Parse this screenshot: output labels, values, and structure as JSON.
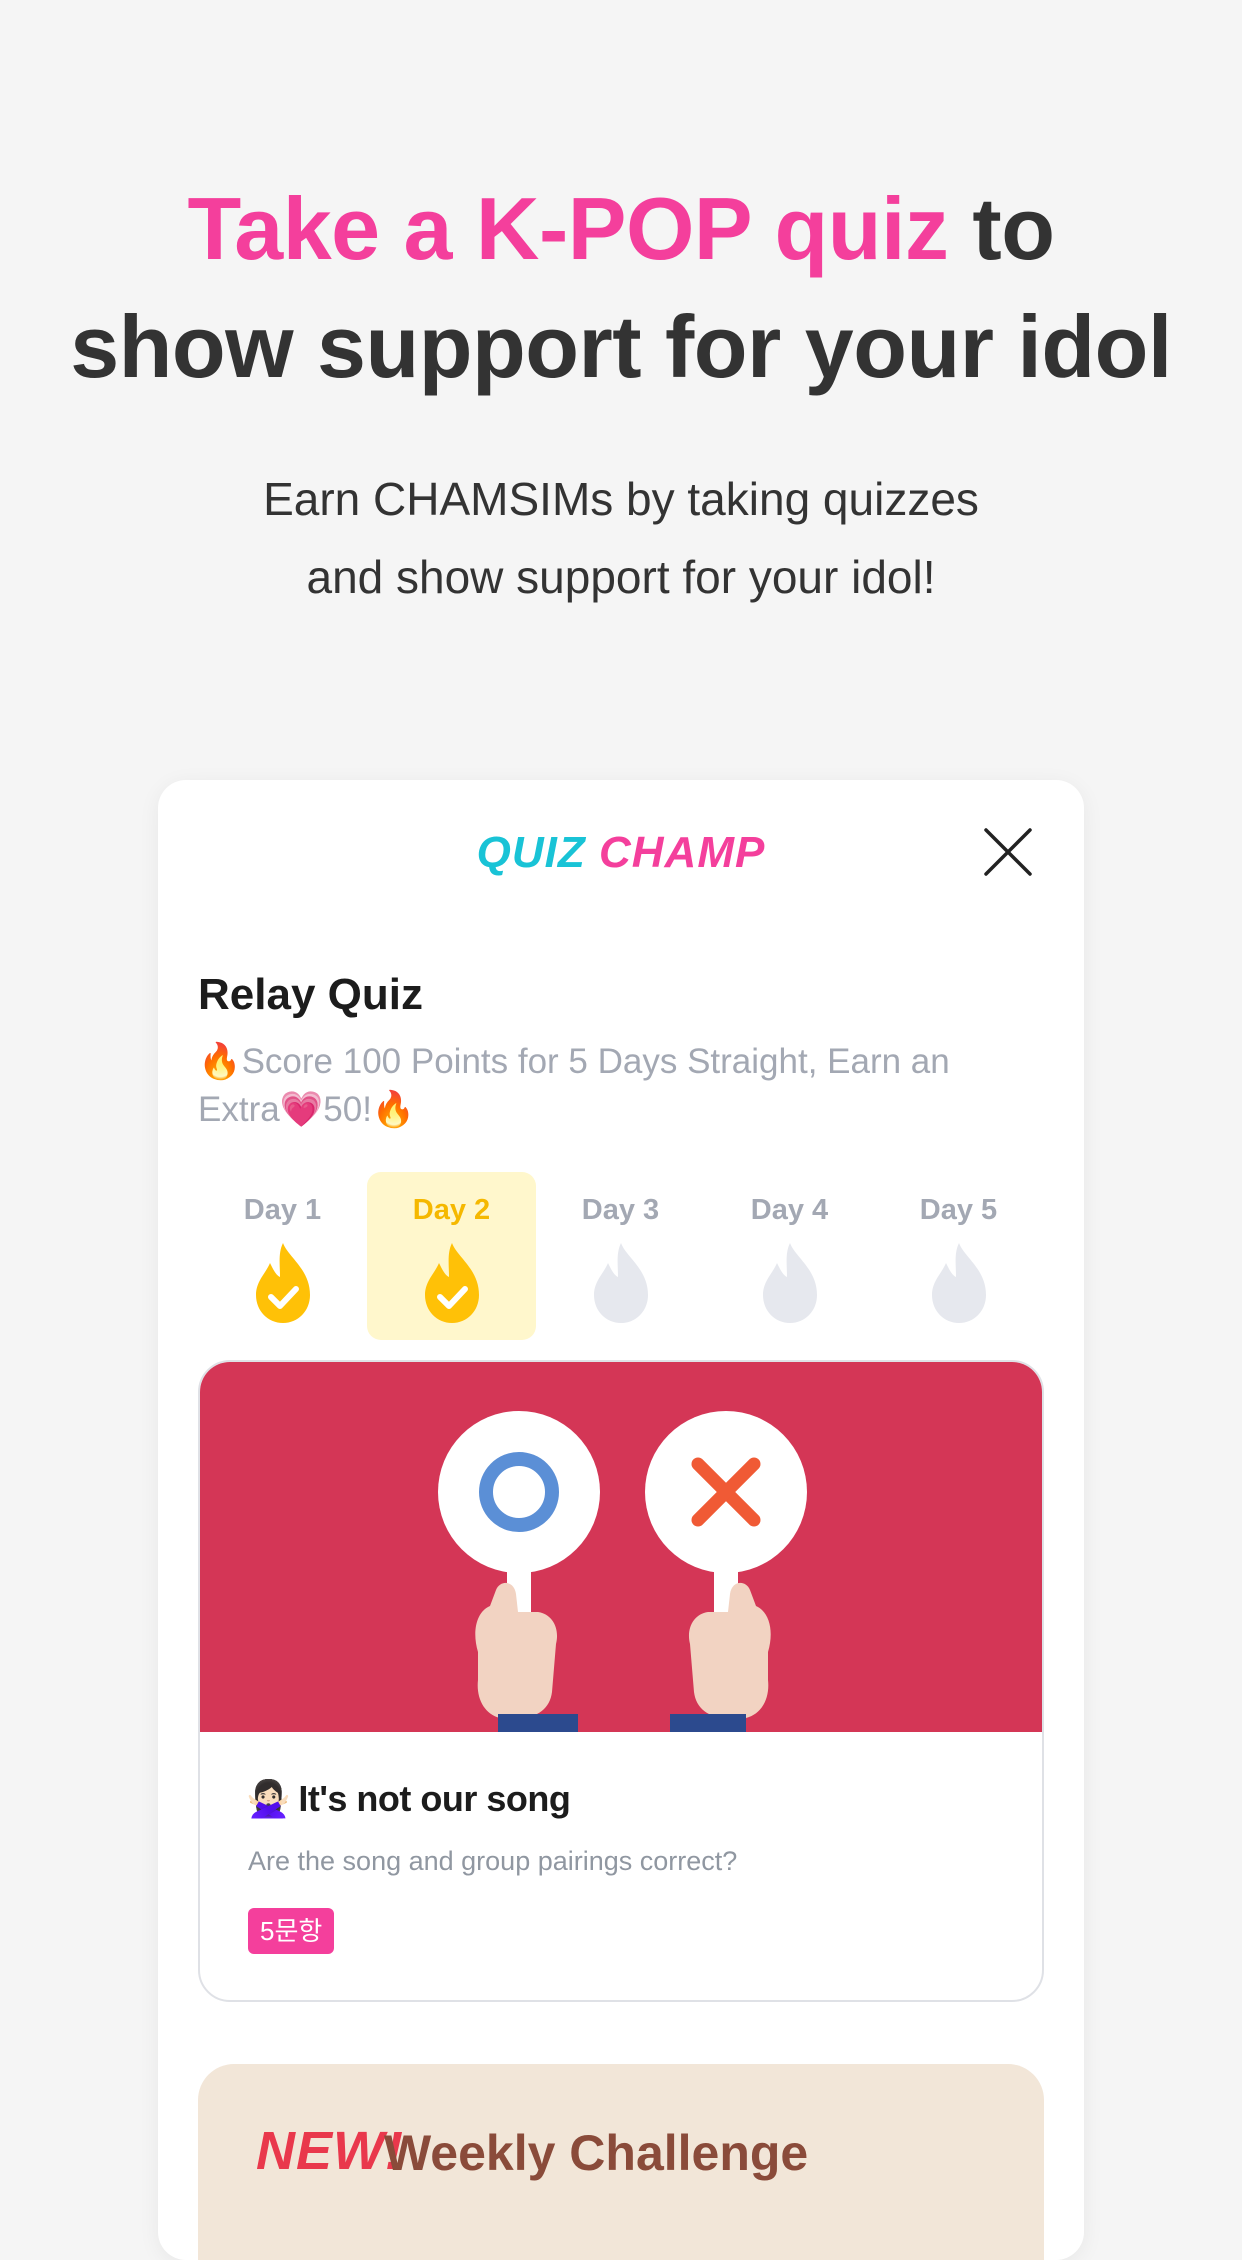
{
  "headline": {
    "highlight": "Take a K-POP quiz",
    "rest_line1": " to",
    "line2": "show support for your idol"
  },
  "subtitle": {
    "line1": "Earn CHAMSIMs by taking quizzes",
    "line2": "and show support for your idol!"
  },
  "card": {
    "brand_quiz": "QUIZ",
    "brand_champ": "CHAMP",
    "relay": {
      "title": "Relay Quiz",
      "subtitle": "🔥Score 100 Points for 5 Days Straight, Earn an Extra💗50!🔥"
    },
    "days": [
      {
        "label": "Day 1",
        "status": "completed"
      },
      {
        "label": "Day 2",
        "status": "completed-current"
      },
      {
        "label": "Day 3",
        "status": "locked"
      },
      {
        "label": "Day 4",
        "status": "locked"
      },
      {
        "label": "Day 5",
        "status": "locked"
      }
    ],
    "quiz": {
      "emoji": "🙅🏻‍♀️",
      "title": "It's not our song",
      "description": "Are the song and group pairings correct?",
      "badge": "5문항"
    },
    "weekly": {
      "new_label": "NEW!",
      "title": "Weekly Challenge"
    }
  },
  "colors": {
    "accent_pink": "#f43f9c",
    "accent_cyan": "#19c3d6",
    "banner_red": "#d43656",
    "flame_yellow": "#ffc107",
    "flame_inactive": "#e6e8ee"
  },
  "icons": {
    "close": "close-icon",
    "flame_done": "flame-check-icon",
    "flame_locked": "flame-icon"
  }
}
